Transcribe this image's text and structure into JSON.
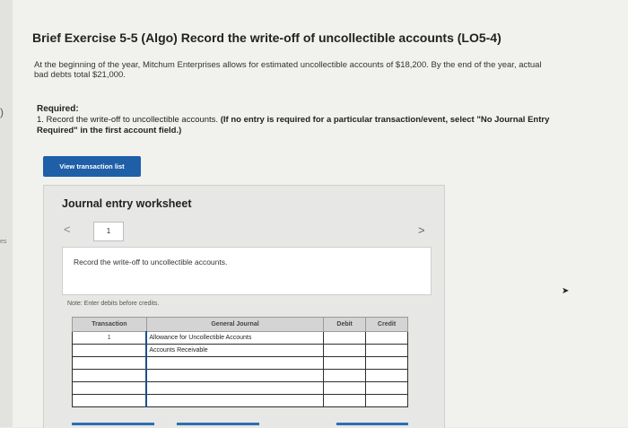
{
  "left_fragment": {
    "arrow": ")",
    "text": "es"
  },
  "exercise": {
    "title": "Brief Exercise 5-5 (Algo) Record the write-off of uncollectible accounts (LO5-4)",
    "intro_line1": "At the beginning of the year, Mitchum Enterprises allows for estimated uncollectible accounts of $18,200. By the end of the year, actual",
    "intro_line2": "bad debts total $21,000."
  },
  "required": {
    "heading": "Required:",
    "item_prefix": "1. Record the write-off to uncollectible accounts. ",
    "instruction_bold": "(If no entry is required for a particular transaction/event, select \"No Journal Entry",
    "instruction_line2": "Required\" in the first account field.)"
  },
  "buttons": {
    "view_transaction_list": "View transaction list"
  },
  "worksheet": {
    "title": "Journal entry worksheet",
    "page_number": "1",
    "nav_prev": "<",
    "nav_next": ">",
    "description": "Record the write-off to uncollectible accounts.",
    "note": "Note: Enter debits before credits."
  },
  "journal_table": {
    "headers": [
      "Transaction",
      "General Journal",
      "Debit",
      "Credit"
    ],
    "rows": [
      {
        "transaction": "1",
        "account": "Allowance for Uncollectible Accounts",
        "debit": "",
        "credit": ""
      },
      {
        "transaction": "",
        "account": "Accounts Receivable",
        "debit": "",
        "credit": ""
      },
      {
        "transaction": "",
        "account": "",
        "debit": "",
        "credit": ""
      },
      {
        "transaction": "",
        "account": "",
        "debit": "",
        "credit": ""
      },
      {
        "transaction": "",
        "account": "",
        "debit": "",
        "credit": ""
      },
      {
        "transaction": "",
        "account": "",
        "debit": "",
        "credit": ""
      }
    ]
  },
  "colors": {
    "accent": "#1f5fa8",
    "background": "#f1f1ee"
  }
}
